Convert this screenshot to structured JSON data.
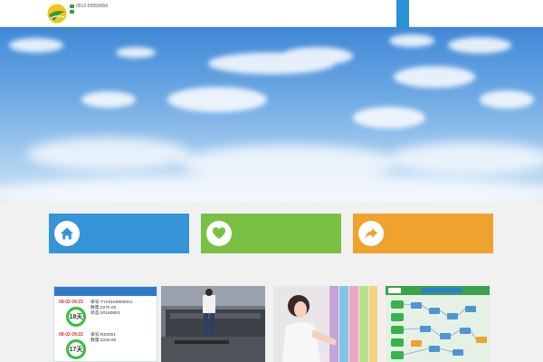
{
  "header": {
    "logo": {
      "company": "",
      "phone": "0512-65559658",
      "mobile": ""
    },
    "nav": [
      {
        "label": "",
        "active": true
      },
      {
        "label": "",
        "active": false
      },
      {
        "label": "",
        "active": false
      },
      {
        "label": "",
        "active": false
      },
      {
        "label": "",
        "active": false
      },
      {
        "label": "",
        "active": false
      },
      {
        "label": "",
        "active": false
      }
    ]
  },
  "features": [
    {
      "title": "",
      "desc": "",
      "icon": "home-icon",
      "color": "#3594d8"
    },
    {
      "title": "",
      "desc": "",
      "icon": "heart-icon",
      "color": "#7ac043"
    },
    {
      "title": "",
      "desc": "",
      "icon": "share-arrow-icon",
      "color": "#f0a22e"
    }
  ],
  "cases": {
    "title": "",
    "order_card": {
      "header": "",
      "rows": [
        {
          "date": "08-02  09:23",
          "days": "18天",
          "line1": "单号:TY20160803001",
          "line2": "",
          "line3": "数量:2270.00",
          "line4": "状态:20160803",
          "links": ""
        },
        {
          "date": "08-02  09:22",
          "days": "17天",
          "line1": "单号:RZ0001",
          "line2": "",
          "line3": "数量:2240.00",
          "line4": "",
          "links": ""
        }
      ]
    }
  },
  "colors": {
    "nav_active": "#2a92d6",
    "brand_green": "#2f9d3b",
    "days_ring": "#2fc238"
  }
}
